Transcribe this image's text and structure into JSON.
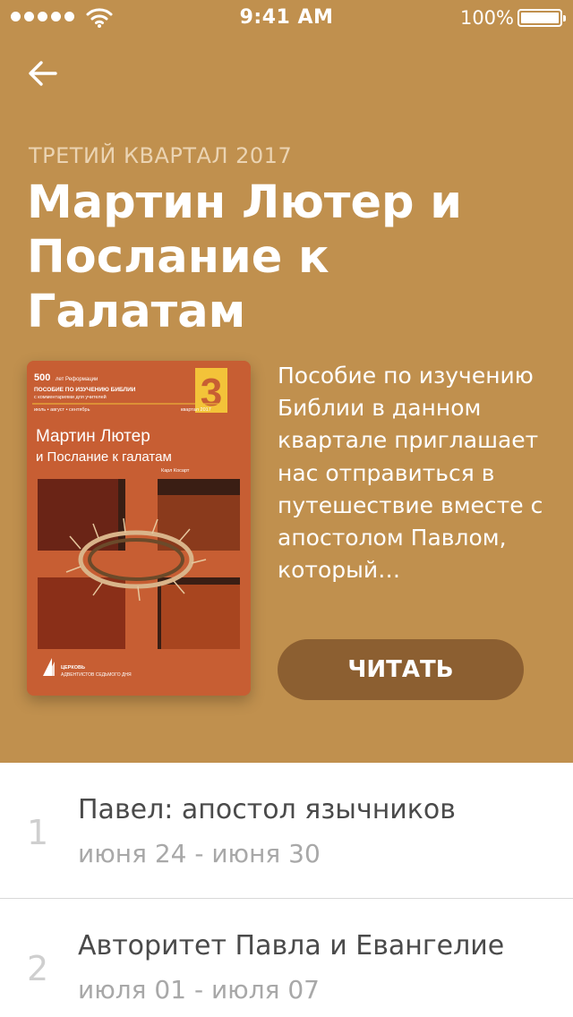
{
  "status_bar": {
    "time": "9:41 AM",
    "battery": "100%"
  },
  "header": {
    "quarter": "ТРЕТИЙ КВАРТАЛ 2017",
    "title": "Мартин Лютер и Послание к Галатам"
  },
  "cover": {
    "badge_number": "500",
    "badge_text": "лет Реформации",
    "guide_line1": "ПОСОБИЕ ПО ИЗУЧЕНИЮ БИБЛИИ",
    "guide_line2": "с комментариями для учителей",
    "months": "июль • август • сентябрь",
    "quarter_number": "3",
    "quarter_text": "квартал 2017",
    "title_line1": "Мартин Лютер",
    "title_line2": "и Послание к галатам",
    "author": "Карл Косарт",
    "church_line1": "ЦЕРКОВЬ",
    "church_line2": "АДВЕНТИСТОВ СЕДЬМОГО ДНЯ"
  },
  "description": "Пособие по изучению Библии в данном квартале приглашает нас отправиться в путешествие вместе с апостолом Павлом, который…",
  "read_button": "ЧИТАТЬ",
  "lessons": [
    {
      "number": "1",
      "title": "Павел: апостол язычников",
      "dates": "июня 24 - июня 30"
    },
    {
      "number": "2",
      "title": "Авторитет Павла и Евангелие",
      "dates": "июля 01 - июля 07"
    }
  ],
  "colors": {
    "hero_background": "#c0904e",
    "button_background": "#8c5f31",
    "quarter_label": "#ebd4b3",
    "cover_orange": "#c75e33"
  },
  "icons": [
    "back-arrow-icon",
    "wifi-icon",
    "signal-icon",
    "battery-icon"
  ]
}
